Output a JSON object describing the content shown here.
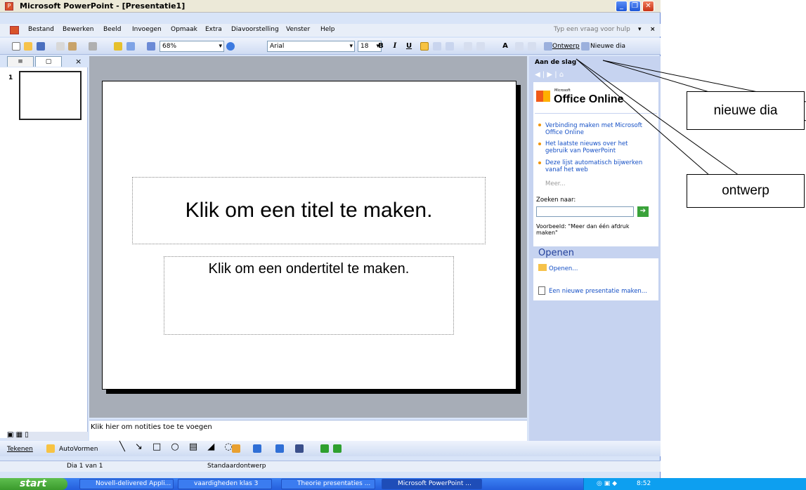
{
  "window": {
    "title": "Microsoft PowerPoint - [Presentatie1]"
  },
  "menu": {
    "items": [
      "Bestand",
      "Bewerken",
      "Beeld",
      "Invoegen",
      "Opmaak",
      "Extra",
      "Diavoorstelling",
      "Venster",
      "Help"
    ],
    "help_placeholder": "Typ een vraag voor hulp"
  },
  "toolbar": {
    "zoom": "68%",
    "font": "Arial",
    "font_size": "18",
    "bold": "B",
    "italic": "I",
    "underline": "U",
    "ontwerp": "Ontwerp",
    "nieuwe_dia": "Nieuwe dia"
  },
  "slides_panel": {
    "slide_number": "1"
  },
  "slide": {
    "title_placeholder": "Klik om een titel te maken.",
    "subtitle_placeholder": "Klik om een ondertitel te maken."
  },
  "notes": {
    "placeholder": "Klik hier om notities toe te voegen"
  },
  "task_pane": {
    "title": "Aan de slag",
    "brand_small": "Microsoft",
    "brand": "Office Online",
    "links": [
      "Verbinding maken met Microsoft Office Online",
      "Het laatste nieuws over het gebruik van PowerPoint",
      "Deze lijst automatisch bijwerken vanaf het web"
    ],
    "more": "Meer...",
    "search_label": "Zoeken naar:",
    "example": "Voorbeeld: \"Meer dan één afdruk maken\"",
    "open_header": "Openen",
    "open_link": "Openen...",
    "new_link": "Een nieuwe presentatie maken..."
  },
  "drawing": {
    "draw_label": "Tekenen",
    "autoshapes_label": "AutoVormen"
  },
  "status": {
    "slide_info": "Dia 1 van 1",
    "design": "Standaardontwerp"
  },
  "taskbar": {
    "start": "start",
    "items": [
      "Novell-delivered Appli...",
      "vaardigheden klas 3",
      "Theorie presentaties ...",
      "Microsoft PowerPoint ..."
    ],
    "clock": "8:52"
  },
  "annotations": {
    "nieuwe_dia": "nieuwe dia",
    "ontwerp": "ontwerp"
  }
}
